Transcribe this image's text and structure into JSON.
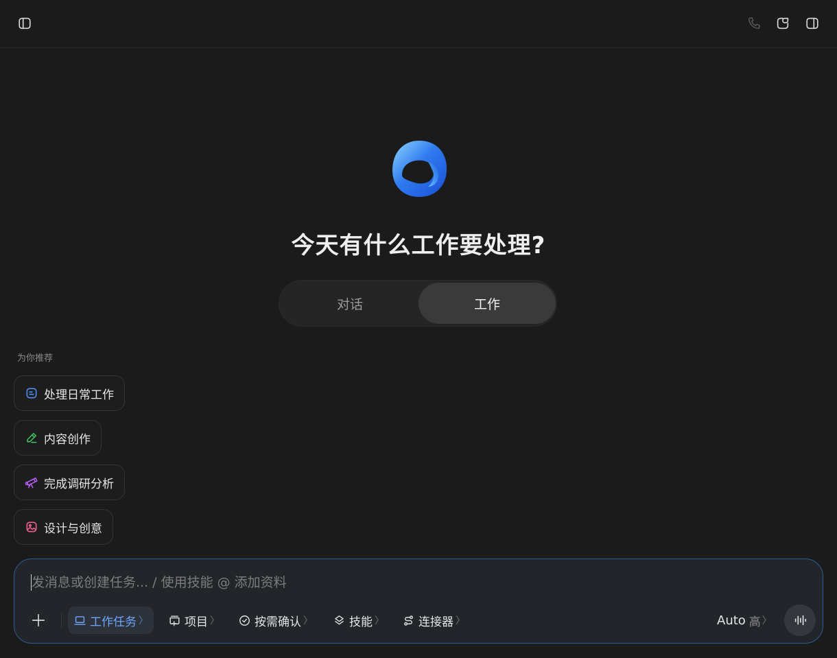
{
  "topbar": {
    "left_icon": "sidebar-toggle-icon",
    "right_icons": [
      "phone-icon",
      "new-chat-icon",
      "right-panel-icon"
    ]
  },
  "main": {
    "headline": "今天有什么工作要处理?",
    "modes": [
      {
        "label": "对话",
        "active": false
      },
      {
        "label": "工作",
        "active": true
      }
    ]
  },
  "recommendations": {
    "title": "为你推荐",
    "items": [
      {
        "label": "处理日常工作",
        "icon": "task-list-icon",
        "color": "#4f8ff7"
      },
      {
        "label": "内容创作",
        "icon": "pencil-icon",
        "color": "#3fbf5f"
      },
      {
        "label": "完成调研分析",
        "icon": "telescope-icon",
        "color": "#b35cf0"
      },
      {
        "label": "设计与创意",
        "icon": "image-icon",
        "color": "#f06292"
      }
    ]
  },
  "composer": {
    "placeholder": "发消息或创建任务... / 使用技能 @ 添加资料",
    "tools": [
      {
        "label": "工作任务",
        "icon": "laptop-icon",
        "active": true
      },
      {
        "label": "项目",
        "icon": "folder-plus-icon"
      },
      {
        "label": "按需确认",
        "icon": "shield-check-icon"
      },
      {
        "label": "技能",
        "icon": "layers-icon"
      },
      {
        "label": "连接器",
        "icon": "connector-icon"
      }
    ],
    "chevron": "〉",
    "model": {
      "name": "Auto",
      "level": "高"
    },
    "accent": "#6ea6ff",
    "border": "#2f5d93"
  }
}
